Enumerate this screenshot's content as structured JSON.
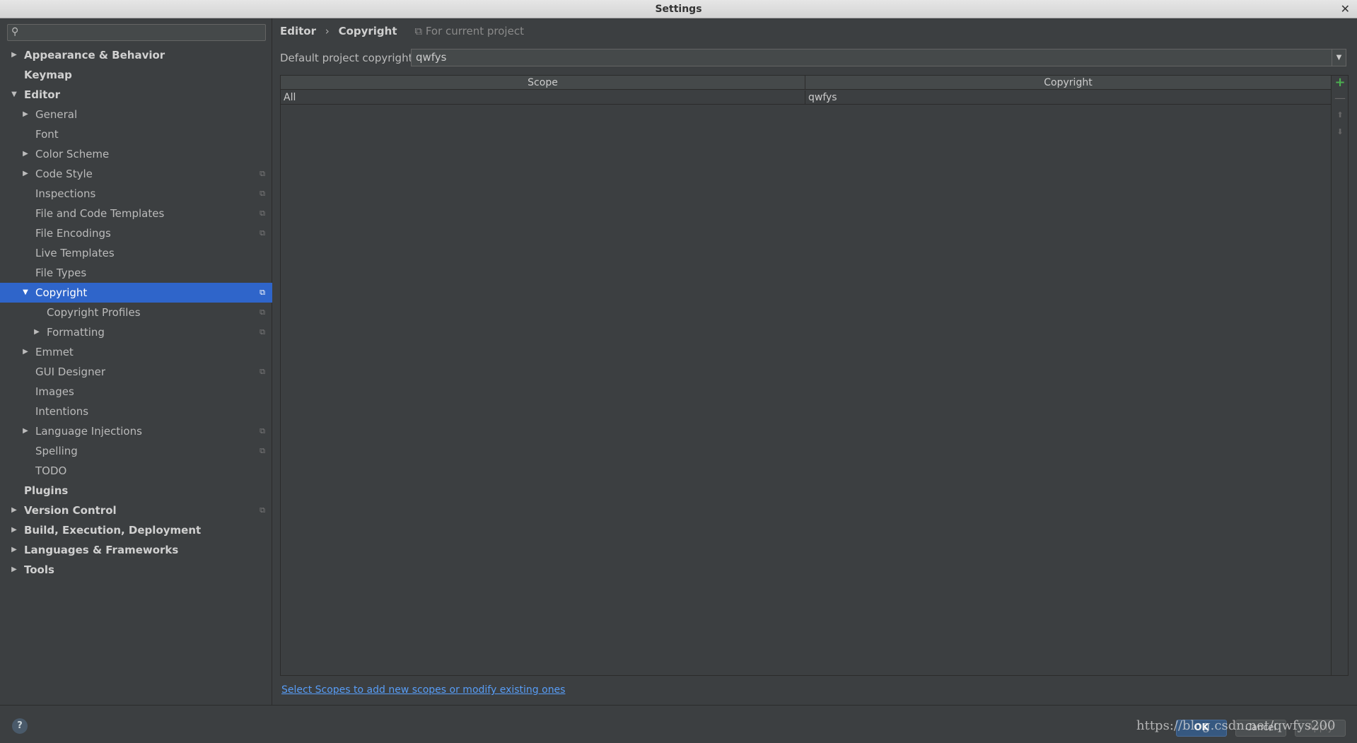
{
  "window": {
    "title": "Settings",
    "close_glyph": "✕"
  },
  "search": {
    "placeholder": "",
    "icon": "search-icon"
  },
  "tree": [
    {
      "label": "Appearance & Behavior",
      "level": 0,
      "arrow": "▶",
      "bold": true,
      "proj": false
    },
    {
      "label": "Keymap",
      "level": 0,
      "arrow": "",
      "bold": true,
      "proj": false
    },
    {
      "label": "Editor",
      "level": 0,
      "arrow": "▼",
      "bold": true,
      "proj": false
    },
    {
      "label": "General",
      "level": 1,
      "arrow": "▶",
      "bold": false,
      "proj": false
    },
    {
      "label": "Font",
      "level": 1,
      "arrow": "",
      "bold": false,
      "proj": false
    },
    {
      "label": "Color Scheme",
      "level": 1,
      "arrow": "▶",
      "bold": false,
      "proj": false
    },
    {
      "label": "Code Style",
      "level": 1,
      "arrow": "▶",
      "bold": false,
      "proj": true
    },
    {
      "label": "Inspections",
      "level": 1,
      "arrow": "",
      "bold": false,
      "proj": true
    },
    {
      "label": "File and Code Templates",
      "level": 1,
      "arrow": "",
      "bold": false,
      "proj": true
    },
    {
      "label": "File Encodings",
      "level": 1,
      "arrow": "",
      "bold": false,
      "proj": true
    },
    {
      "label": "Live Templates",
      "level": 1,
      "arrow": "",
      "bold": false,
      "proj": false
    },
    {
      "label": "File Types",
      "level": 1,
      "arrow": "",
      "bold": false,
      "proj": false
    },
    {
      "label": "Copyright",
      "level": 1,
      "arrow": "▼",
      "bold": false,
      "proj": true,
      "selected": true
    },
    {
      "label": "Copyright Profiles",
      "level": 2,
      "arrow": "",
      "bold": false,
      "proj": true
    },
    {
      "label": "Formatting",
      "level": 2,
      "arrow": "▶",
      "bold": false,
      "proj": true
    },
    {
      "label": "Emmet",
      "level": 1,
      "arrow": "▶",
      "bold": false,
      "proj": false
    },
    {
      "label": "GUI Designer",
      "level": 1,
      "arrow": "",
      "bold": false,
      "proj": true
    },
    {
      "label": "Images",
      "level": 1,
      "arrow": "",
      "bold": false,
      "proj": false
    },
    {
      "label": "Intentions",
      "level": 1,
      "arrow": "",
      "bold": false,
      "proj": false
    },
    {
      "label": "Language Injections",
      "level": 1,
      "arrow": "▶",
      "bold": false,
      "proj": true
    },
    {
      "label": "Spelling",
      "level": 1,
      "arrow": "",
      "bold": false,
      "proj": true
    },
    {
      "label": "TODO",
      "level": 1,
      "arrow": "",
      "bold": false,
      "proj": false
    },
    {
      "label": "Plugins",
      "level": 0,
      "arrow": "",
      "bold": true,
      "proj": false
    },
    {
      "label": "Version Control",
      "level": 0,
      "arrow": "▶",
      "bold": true,
      "proj": true
    },
    {
      "label": "Build, Execution, Deployment",
      "level": 0,
      "arrow": "▶",
      "bold": true,
      "proj": false
    },
    {
      "label": "Languages & Frameworks",
      "level": 0,
      "arrow": "▶",
      "bold": true,
      "proj": false
    },
    {
      "label": "Tools",
      "level": 0,
      "arrow": "▶",
      "bold": true,
      "proj": false
    }
  ],
  "proj_glyph": "⧉",
  "breadcrumb": {
    "parent": "Editor",
    "separator": "›",
    "current": "Copyright",
    "for_project": "For current project",
    "for_project_icon": "⧉"
  },
  "default_copyright": {
    "label": "Default project copyright:",
    "value": "qwfys",
    "dropdown_glyph": "▼"
  },
  "table": {
    "headers": {
      "scope": "Scope",
      "copyright": "Copyright"
    },
    "rows": [
      {
        "scope": "All",
        "copyright": "qwfys"
      }
    ]
  },
  "toolbar": {
    "add": "+",
    "remove": "—",
    "up": "⬆",
    "down": "⬇"
  },
  "scopes_link": "Select Scopes to add new scopes or modify existing ones",
  "footer": {
    "help": "?",
    "ok": "OK",
    "cancel": "Cancel",
    "apply": "Apply",
    "watermark": "https://blog.csdn.net/qwfys200"
  },
  "colors": {
    "selection": "#2f65ca",
    "link": "#589df6",
    "add": "#4caf50",
    "background": "#3c3f41"
  }
}
